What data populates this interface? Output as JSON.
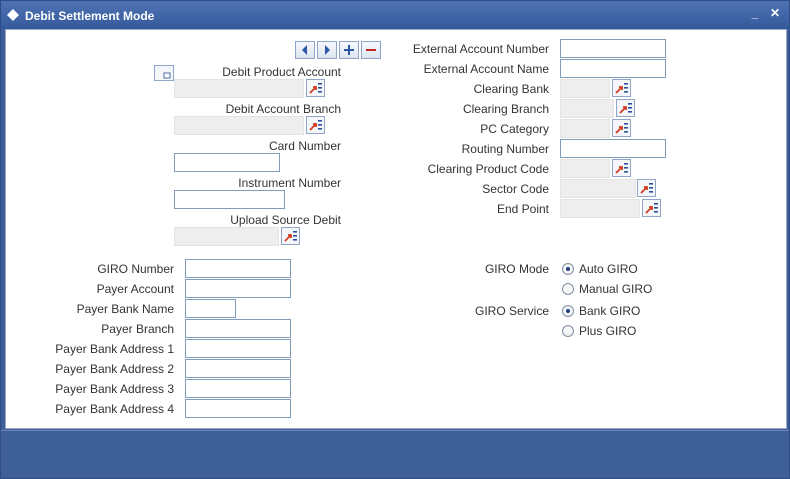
{
  "window": {
    "title": "Debit Settlement Mode",
    "minimize": "_",
    "close": "✕"
  },
  "nav": {
    "icons": [
      "previous-icon",
      "next-icon",
      "add-icon",
      "delete-icon"
    ]
  },
  "left": {
    "debit_product_account": "Debit Product Account",
    "debit_account_branch": "Debit Account Branch",
    "card_number": "Card Number",
    "instrument_number": "Instrument Number",
    "upload_source_debit": "Upload Source Debit"
  },
  "right": {
    "external_account_number": "External Account Number",
    "external_account_name": "External Account Name",
    "clearing_bank": "Clearing Bank",
    "clearing_branch": "Clearing Branch",
    "pc_category": "PC Category",
    "routing_number": "Routing Number",
    "clearing_product_code": "Clearing Product Code",
    "sector_code": "Sector Code",
    "end_point": "End Point"
  },
  "giro": {
    "giro_number": "GIRO Number",
    "payer_account": "Payer Account",
    "payer_bank_name": "Payer Bank Name",
    "payer_branch": "Payer Branch",
    "payer_bank_address_1": "Payer Bank Address 1",
    "payer_bank_address_2": "Payer Bank Address 2",
    "payer_bank_address_3": "Payer Bank Address 3",
    "payer_bank_address_4": "Payer Bank Address 4",
    "giro_mode": "GIRO Mode",
    "auto_giro": "Auto GIRO",
    "manual_giro": "Manual GIRO",
    "giro_service": "GIRO Service",
    "bank_giro": "Bank GIRO",
    "plus_giro": "Plus GIRO",
    "selected_mode": "Auto GIRO",
    "selected_service": "Bank GIRO"
  }
}
